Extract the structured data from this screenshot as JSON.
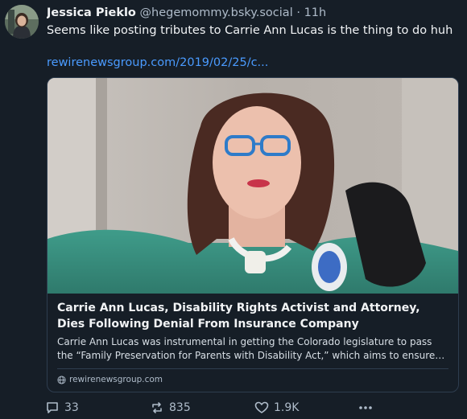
{
  "post": {
    "author_name": "Jessica Pieklo",
    "handle": "@hegemommy.bsky.social",
    "separator": "·",
    "time": "11h",
    "text": "Seems like posting tributes to Carrie Ann Lucas is the thing to do huh",
    "link": "rewirenewsgroup.com/2019/02/25/c..."
  },
  "card": {
    "title": "Carrie Ann Lucas, Disability Rights Activist and Attorney, Dies Following Denial From Insurance Company",
    "description": "Carrie Ann Lucas was instrumental in getting the Colorado legislature to pass the “Family Preservation for Parents with Disability Act,” which aims to ensure parents with disabilities are not discriminated against in custody proceedings.",
    "domain": "rewirenewsgroup.com"
  },
  "actions": {
    "replies": "33",
    "reposts": "835",
    "likes": "1.9K"
  },
  "icons": {
    "reply": "reply-icon",
    "repost": "repost-icon",
    "like": "heart-icon",
    "more": "more-icon",
    "globe": "globe-icon"
  },
  "colors": {
    "background": "#161e27",
    "link": "#4a9bff",
    "muted": "#aebbc9",
    "border": "#2e3d4f"
  }
}
